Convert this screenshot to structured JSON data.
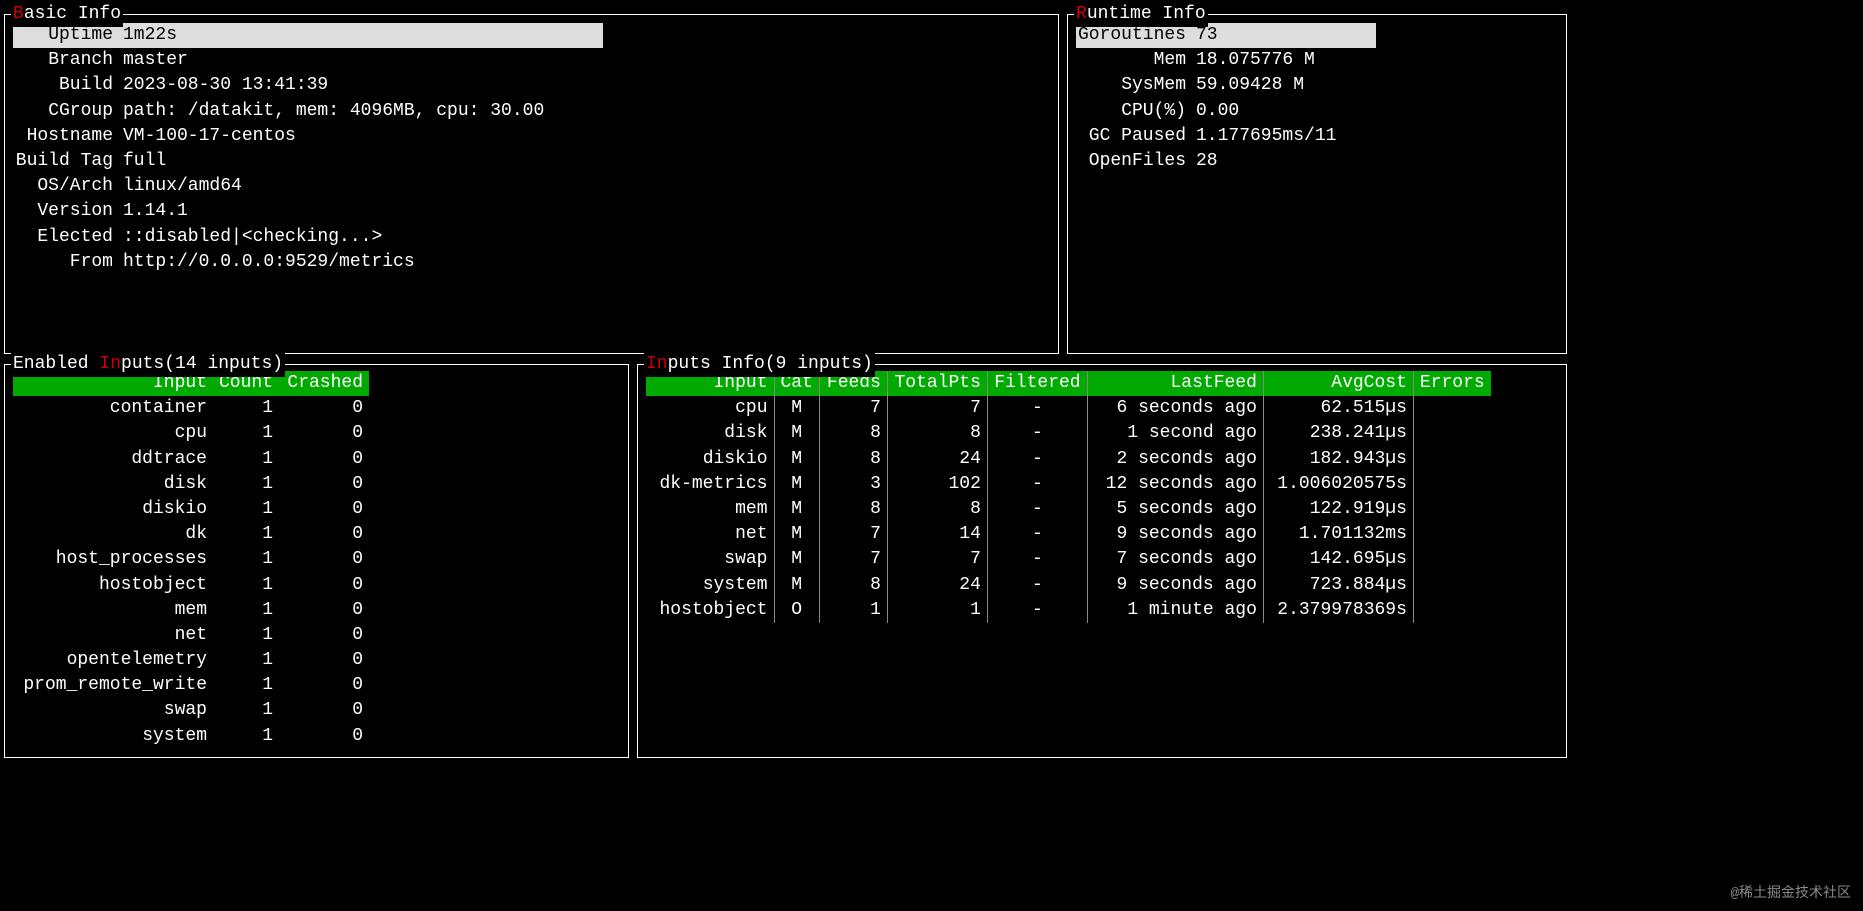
{
  "basic": {
    "title_prefix": "B",
    "title_rest": "asic Info",
    "rows": [
      {
        "label": "Uptime",
        "value": "1m22s",
        "selected": true
      },
      {
        "label": "Branch",
        "value": "master"
      },
      {
        "label": "Build",
        "value": "2023-08-30 13:41:39"
      },
      {
        "label": "CGroup",
        "value": "path: /datakit, mem: 4096MB, cpu: 30.00"
      },
      {
        "label": "Hostname",
        "value": "VM-100-17-centos"
      },
      {
        "label": "Build Tag",
        "value": "full"
      },
      {
        "label": "OS/Arch",
        "value": "linux/amd64"
      },
      {
        "label": "Version",
        "value": "1.14.1"
      },
      {
        "label": "Elected",
        "value": "::disabled|<checking...>"
      },
      {
        "label": "From",
        "value": "http://0.0.0.0:9529/metrics"
      }
    ]
  },
  "runtime": {
    "title_prefix": "R",
    "title_rest": "untime Info",
    "rows": [
      {
        "label": "Goroutines",
        "value": "73",
        "selected": true
      },
      {
        "label": "Mem",
        "value": "18.075776 M"
      },
      {
        "label": "SysMem",
        "value": "59.09428 M"
      },
      {
        "label": "CPU(%)",
        "value": "0.00"
      },
      {
        "label": "GC Paused",
        "value": "1.177695ms/11"
      },
      {
        "label": "OpenFiles",
        "value": "28"
      }
    ]
  },
  "enabled": {
    "title_pre": "Enabled ",
    "title_hl": "In",
    "title_post": "puts(14 inputs)",
    "headers": [
      "Input",
      "Count",
      "Crashed"
    ],
    "rows": [
      {
        "input": "container",
        "count": "1",
        "crashed": "0"
      },
      {
        "input": "cpu",
        "count": "1",
        "crashed": "0"
      },
      {
        "input": "ddtrace",
        "count": "1",
        "crashed": "0"
      },
      {
        "input": "disk",
        "count": "1",
        "crashed": "0"
      },
      {
        "input": "diskio",
        "count": "1",
        "crashed": "0"
      },
      {
        "input": "dk",
        "count": "1",
        "crashed": "0"
      },
      {
        "input": "host_processes",
        "count": "1",
        "crashed": "0"
      },
      {
        "input": "hostobject",
        "count": "1",
        "crashed": "0"
      },
      {
        "input": "mem",
        "count": "1",
        "crashed": "0"
      },
      {
        "input": "net",
        "count": "1",
        "crashed": "0"
      },
      {
        "input": "opentelemetry",
        "count": "1",
        "crashed": "0"
      },
      {
        "input": "prom_remote_write",
        "count": "1",
        "crashed": "0"
      },
      {
        "input": "swap",
        "count": "1",
        "crashed": "0"
      },
      {
        "input": "system",
        "count": "1",
        "crashed": "0"
      }
    ]
  },
  "inputs": {
    "title_hl": "In",
    "title_post": "puts Info(9 inputs)",
    "headers": [
      "Input",
      "Cat",
      "Feeds",
      "TotalPts",
      "Filtered",
      "LastFeed",
      "AvgCost",
      "Errors"
    ],
    "rows": [
      {
        "input": "cpu",
        "cat": "M",
        "feeds": "7",
        "totalpts": "7",
        "filtered": "-",
        "lastfeed": "6 seconds ago",
        "avgcost": "62.515µs",
        "errors": ""
      },
      {
        "input": "disk",
        "cat": "M",
        "feeds": "8",
        "totalpts": "8",
        "filtered": "-",
        "lastfeed": "1 second ago",
        "avgcost": "238.241µs",
        "errors": ""
      },
      {
        "input": "diskio",
        "cat": "M",
        "feeds": "8",
        "totalpts": "24",
        "filtered": "-",
        "lastfeed": "2 seconds ago",
        "avgcost": "182.943µs",
        "errors": ""
      },
      {
        "input": "dk-metrics",
        "cat": "M",
        "feeds": "3",
        "totalpts": "102",
        "filtered": "-",
        "lastfeed": "12 seconds ago",
        "avgcost": "1.006020575s",
        "errors": ""
      },
      {
        "input": "mem",
        "cat": "M",
        "feeds": "8",
        "totalpts": "8",
        "filtered": "-",
        "lastfeed": "5 seconds ago",
        "avgcost": "122.919µs",
        "errors": ""
      },
      {
        "input": "net",
        "cat": "M",
        "feeds": "7",
        "totalpts": "14",
        "filtered": "-",
        "lastfeed": "9 seconds ago",
        "avgcost": "1.701132ms",
        "errors": ""
      },
      {
        "input": "swap",
        "cat": "M",
        "feeds": "7",
        "totalpts": "7",
        "filtered": "-",
        "lastfeed": "7 seconds ago",
        "avgcost": "142.695µs",
        "errors": ""
      },
      {
        "input": "system",
        "cat": "M",
        "feeds": "8",
        "totalpts": "24",
        "filtered": "-",
        "lastfeed": "9 seconds ago",
        "avgcost": "723.884µs",
        "errors": ""
      },
      {
        "input": "hostobject",
        "cat": "O",
        "feeds": "1",
        "totalpts": "1",
        "filtered": "-",
        "lastfeed": "1 minute ago",
        "avgcost": "2.379978369s",
        "errors": ""
      }
    ]
  },
  "watermark": "@稀土掘金技术社区"
}
